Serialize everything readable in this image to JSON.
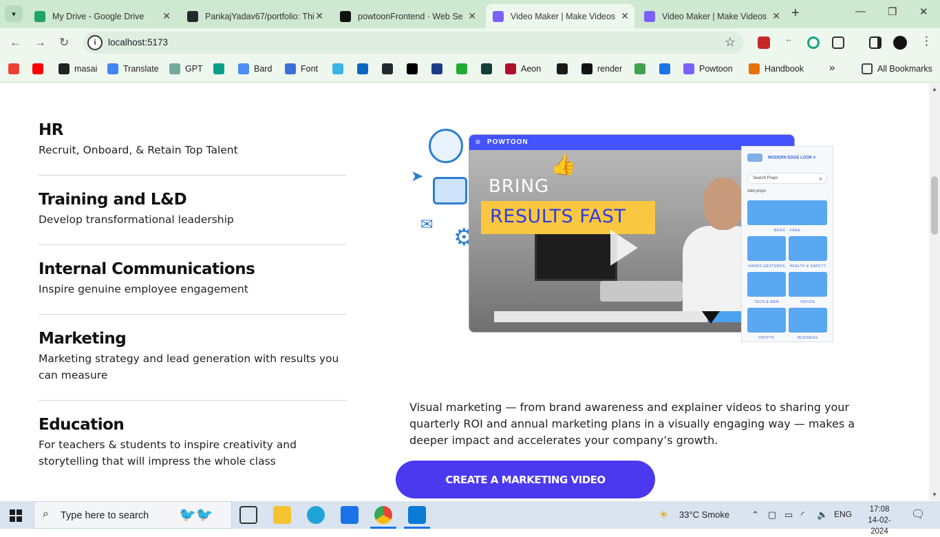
{
  "browser": {
    "tabs": [
      {
        "title": "My Drive - Google Drive",
        "color": "#1fa463"
      },
      {
        "title": "PankajYadav67/portfolio: Thi",
        "color": "#24292f"
      },
      {
        "title": "powtoonFrontend · Web Se",
        "color": "#111111"
      },
      {
        "title": "Video Maker | Make Videos",
        "color": "#7b61ff"
      },
      {
        "title": "Video Maker | Make Videos",
        "color": "#7b61ff"
      }
    ],
    "active_tab": 3,
    "url": "localhost:5173",
    "bookmarks": [
      {
        "label": "",
        "color": "#ea4335"
      },
      {
        "label": "",
        "color": "#ff0000"
      },
      {
        "label": "masai",
        "color": "#222222"
      },
      {
        "label": "Translate",
        "color": "#4285f4"
      },
      {
        "label": "GPT",
        "color": "#74aa9c"
      },
      {
        "label": "",
        "color": "#0a9e8a"
      },
      {
        "label": "Bard",
        "color": "#4c8df6"
      },
      {
        "label": "Font",
        "color": "#3b6fd8"
      },
      {
        "label": "",
        "color": "#3bb4e6"
      },
      {
        "label": "",
        "color": "#0a66c2"
      },
      {
        "label": "",
        "color": "#24292f"
      },
      {
        "label": "",
        "color": "#000000"
      },
      {
        "label": "",
        "color": "#1e3a8a"
      },
      {
        "label": "",
        "color": "#22aa33"
      },
      {
        "label": "",
        "color": "#123d3a"
      },
      {
        "label": "Aeon",
        "color": "#b0102c"
      },
      {
        "label": "",
        "color": "#1a1a1a"
      },
      {
        "label": "render",
        "color": "#111111"
      },
      {
        "label": "",
        "color": "#3fa34d"
      },
      {
        "label": "",
        "color": "#1a73e8"
      },
      {
        "label": "Powtoon",
        "color": "#7b61ff"
      },
      {
        "label": "Handbook",
        "color": "#e8710a"
      }
    ],
    "all_bookmarks": "All Bookmarks"
  },
  "categories": [
    {
      "title": "HR",
      "desc": "Recruit, Onboard, & Retain Top Talent"
    },
    {
      "title": "Training and L&D",
      "desc": "Develop transformational leadership"
    },
    {
      "title": "Internal Communications",
      "desc": "Inspire genuine employee engagement"
    },
    {
      "title": "Marketing",
      "desc": "Marketing strategy and lead generation with results you can measure"
    },
    {
      "title": "Education",
      "desc": "For teachers & students to inspire creativity and storytelling that will impress the whole class"
    }
  ],
  "hero": {
    "brand": "POWTOON",
    "headline_1": "BRING",
    "headline_2": "RESULTS FAST",
    "props_panel": {
      "style": "MODERN EDGE LOOK",
      "search_placeholder": "Search Props",
      "add_label": "Add props",
      "tiles": [
        "BASIC - FREE",
        "HANDS GESTURES",
        "HEALTH & SAFETY",
        "TECH & WEB",
        "OFFICE",
        "CRYPTO",
        "BUSINESS"
      ]
    }
  },
  "marketing_description": "Visual marketing — from brand awareness and explainer videos to sharing your quarterly ROI and annual marketing plans in a visually engaging way — makes a deeper impact and accelerates your company’s growth.",
  "cta_label": "CREATE A MARKETING VIDEO",
  "taskbar": {
    "search_placeholder": "Type here to search",
    "weather": "33°C  Smoke",
    "lang": "ENG",
    "time": "17:08",
    "date": "14-02-2024"
  }
}
